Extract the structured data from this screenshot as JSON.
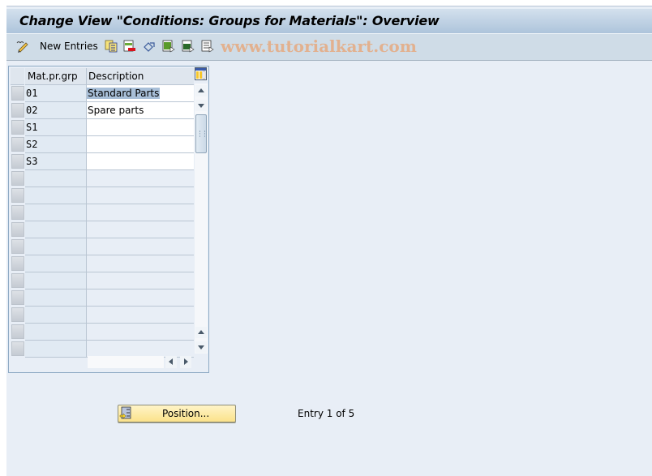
{
  "window": {
    "title": "Change View \"Conditions: Groups for Materials\": Overview"
  },
  "toolbar": {
    "items": [
      {
        "icon": "display-change-icon",
        "label": ""
      },
      {
        "icon": "new-entries-label",
        "label": "New Entries"
      },
      {
        "icon": "copy-as-icon",
        "label": ""
      },
      {
        "icon": "delete-icon",
        "label": ""
      },
      {
        "icon": "undo-change-icon",
        "label": ""
      },
      {
        "icon": "select-all-icon",
        "label": ""
      },
      {
        "icon": "select-block-icon",
        "label": ""
      },
      {
        "icon": "deselect-all-icon",
        "label": ""
      }
    ],
    "watermark": "www.tutorialkart.com"
  },
  "table": {
    "columns": [
      "Mat.pr.grp",
      "Description"
    ],
    "rows": [
      {
        "code": "01",
        "description": "Standard Parts",
        "selected_text": true
      },
      {
        "code": "02",
        "description": "Spare parts"
      },
      {
        "code": "S1",
        "description": ""
      },
      {
        "code": "S2",
        "description": ""
      },
      {
        "code": "S3",
        "description": ""
      }
    ],
    "empty_rows": 11
  },
  "footer": {
    "position_button": "Position...",
    "entry_info": "Entry 1 of 5"
  },
  "colors": {
    "title_bar": "#adc4db",
    "toolbar": "#cfdce7",
    "background": "#e8eef6",
    "button_yellow": "#fbe28a",
    "selection": "#a8bfd8",
    "watermark": "#e7a77a"
  }
}
